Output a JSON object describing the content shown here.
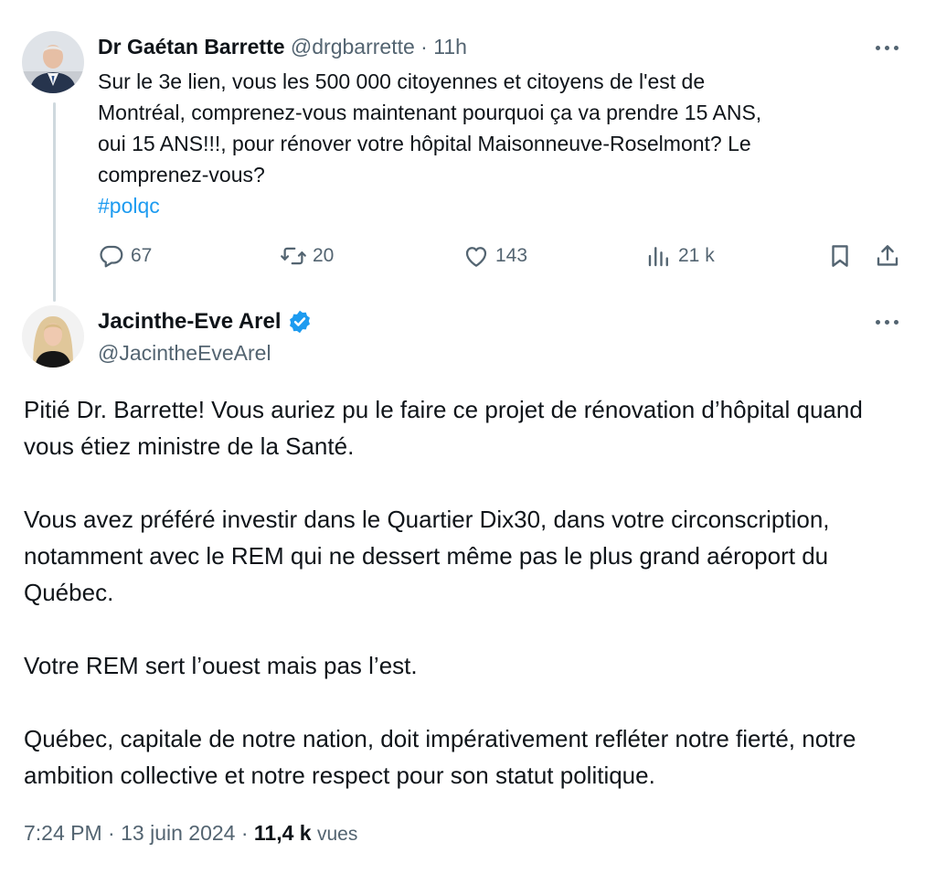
{
  "parent_tweet": {
    "author_name": "Dr Gaétan Barrette",
    "handle": "@drgbarrette",
    "separator": "·",
    "time_ago": "11h",
    "text_lines": [
      "Sur le 3e lien, vous les 500 000 citoyennes et citoyens de l'est de",
      "Montréal, comprenez-vous maintenant pourquoi ça va prendre 15 ANS,",
      "oui 15 ANS!!!, pour rénover votre hôpital Maisonneuve-Roselmont? Le",
      "comprenez-vous?"
    ],
    "hashtag": "#polqc",
    "replies": "67",
    "reposts": "20",
    "likes": "143",
    "views": "21 k"
  },
  "main_tweet": {
    "author_name": "Jacinthe-Eve Arel",
    "handle": "@JacintheEveArel",
    "verified": true,
    "paragraphs": [
      "Pitié Dr. Barrette! Vous auriez pu le faire ce projet de rénovation d’hôpital quand vous étiez ministre de la Santé.",
      "Vous avez préféré investir dans le Quartier Dix30, dans votre circonscription, notamment avec le REM qui ne dessert même pas le plus grand aéroport du Québec.",
      "Votre REM sert l’ouest mais pas l’est.",
      "Québec, capitale de notre nation, doit impérativement refléter notre fierté, notre ambition collective et notre respect pour son statut politique."
    ],
    "time": "7:24 PM",
    "separator": "·",
    "date": "13 juin 2024",
    "views_count": "11,4 k",
    "views_label": "vues"
  },
  "icons": {
    "more": "more-horizontal-icon",
    "reply": "reply-icon",
    "repost": "repost-icon",
    "like": "heart-icon",
    "views": "views-icon",
    "bookmark": "bookmark-icon",
    "share": "share-icon",
    "verified": "verified-badge-icon"
  },
  "colors": {
    "text": "#0f1419",
    "secondary": "#536471",
    "link": "#1d9bf0",
    "thread_line": "#cfd9de"
  }
}
